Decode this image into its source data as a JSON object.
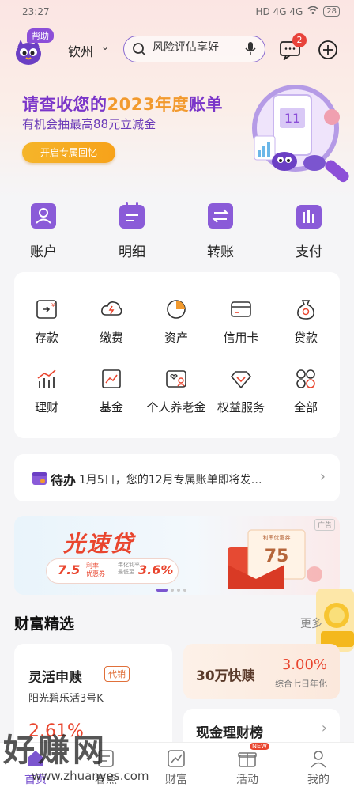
{
  "status_bar": {
    "time": "23:27",
    "signals": "HD  4G  4G",
    "battery": "28"
  },
  "header": {
    "help_label": "帮助",
    "city": "钦州",
    "search_placeholder": "风险评估享好",
    "message_badge": "2"
  },
  "banner": {
    "title_pre": "请查收您的",
    "title_year": "2023年度",
    "title_post": "账单",
    "subtitle": "有机会抽最高88元立减金",
    "button": "开启专属回忆"
  },
  "quick_actions": [
    {
      "label": "账户",
      "icon": "account-icon"
    },
    {
      "label": "明细",
      "icon": "details-icon"
    },
    {
      "label": "转账",
      "icon": "transfer-icon"
    },
    {
      "label": "支付",
      "icon": "payment-icon"
    }
  ],
  "services": [
    {
      "label": "存款",
      "icon": "deposit-icon"
    },
    {
      "label": "缴费",
      "icon": "bill-payment-icon"
    },
    {
      "label": "资产",
      "icon": "assets-icon"
    },
    {
      "label": "信用卡",
      "icon": "credit-card-icon"
    },
    {
      "label": "贷款",
      "icon": "loan-icon"
    },
    {
      "label": "理财",
      "icon": "wealth-chart-icon"
    },
    {
      "label": "基金",
      "icon": "fund-icon"
    },
    {
      "label": "个人养老金",
      "icon": "pension-icon"
    },
    {
      "label": "权益服务",
      "icon": "diamond-icon"
    },
    {
      "label": "全部",
      "icon": "all-grid-icon"
    }
  ],
  "notice": {
    "tag": "待办",
    "text": "1月5日，您的12月专属账单即将发…"
  },
  "loan_banner": {
    "title": "光速贷",
    "rate_value": "7.5",
    "rate_label_1": "利率",
    "rate_label_2": "优惠券",
    "low_label_1": "年化利率",
    "low_label_2": "最低至",
    "low_value": "3.6%",
    "ad_tag": "广告",
    "coupon_title": "利率优惠券",
    "coupon_value": "75"
  },
  "wealth": {
    "title": "财富精选",
    "more": "更多",
    "product1": {
      "name": "灵活申赎",
      "tag": "代销",
      "sub": "阳光碧乐活3号K",
      "rate": "2.61%"
    },
    "product2": {
      "name": "30万快赎",
      "rate": "3.00%",
      "sub": "综合七日年化"
    },
    "product3": {
      "name": "现金理财榜"
    }
  },
  "tabs": [
    {
      "label": "首页",
      "active": true
    },
    {
      "label": "看点",
      "active": false
    },
    {
      "label": "财富",
      "active": false
    },
    {
      "label": "活动",
      "active": false,
      "badge": "NEW"
    },
    {
      "label": "我的",
      "active": false
    }
  ],
  "watermark": {
    "big": "好赚网",
    "small": "www.zhuanyes.com"
  },
  "colors": {
    "brand": "#7b55cf",
    "accent_red": "#e9452e",
    "accent_orange": "#f29a2e"
  }
}
